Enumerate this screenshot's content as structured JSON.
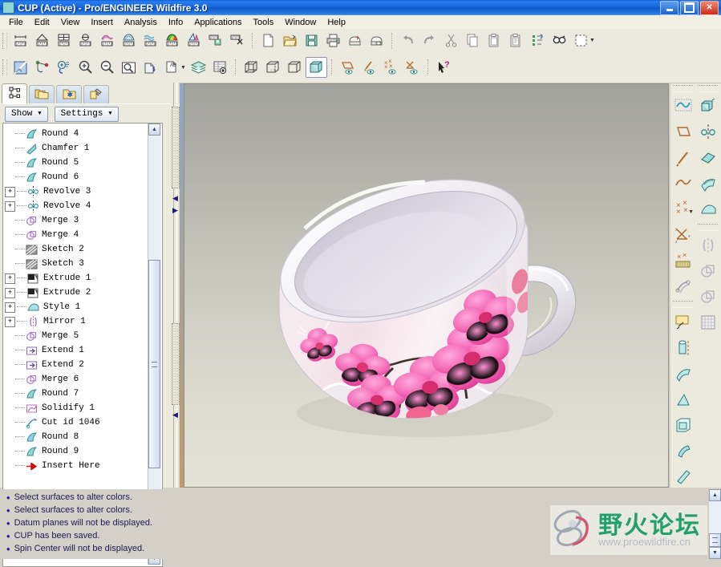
{
  "window": {
    "title": "CUP (Active) - Pro/ENGINEER Wildfire 3.0",
    "app_icon": "cup-model-icon",
    "minimize_label": "Minimize",
    "maximize_label": "Maximize",
    "close_label": "Close",
    "close_glyph": "✕"
  },
  "menubar": {
    "items": [
      {
        "label": "File"
      },
      {
        "label": "Edit"
      },
      {
        "label": "View"
      },
      {
        "label": "Insert"
      },
      {
        "label": "Analysis"
      },
      {
        "label": "Info"
      },
      {
        "label": "Applications"
      },
      {
        "label": "Tools"
      },
      {
        "label": "Window"
      },
      {
        "label": "Help"
      }
    ]
  },
  "toolbar_analysis": {
    "buttons": [
      {
        "name": "measure-distance-icon",
        "title": "Distance"
      },
      {
        "name": "measure-angle-icon",
        "title": "Angle"
      },
      {
        "name": "measure-area-icon",
        "title": "Area"
      },
      {
        "name": "measure-diameter-icon",
        "title": "Diameter"
      },
      {
        "name": "curvature-analysis-icon",
        "title": "Curvature"
      },
      {
        "name": "surface-analysis-icon",
        "title": "Surface Analysis"
      },
      {
        "name": "section-analysis-icon",
        "title": "Sections"
      },
      {
        "name": "shaded-curvature-icon",
        "title": "Shaded Curvature"
      },
      {
        "name": "draft-check-icon",
        "title": "Draft Check"
      },
      {
        "name": "save-analysis-icon",
        "title": "Save Analysis"
      },
      {
        "name": "delete-analysis-icon",
        "title": "Delete Analysis"
      }
    ]
  },
  "toolbar_file": {
    "buttons": [
      {
        "name": "new-file-icon",
        "title": "New"
      },
      {
        "name": "open-file-icon",
        "title": "Open"
      },
      {
        "name": "save-file-icon",
        "title": "Save"
      },
      {
        "name": "print-icon",
        "title": "Print"
      },
      {
        "name": "mail-model-icon",
        "title": "Send Mail"
      },
      {
        "name": "web-link-icon",
        "title": "Web Link"
      },
      {
        "name": "undo-icon",
        "title": "Undo"
      },
      {
        "name": "redo-icon",
        "title": "Redo"
      },
      {
        "name": "cut-icon",
        "title": "Cut"
      },
      {
        "name": "copy-icon",
        "title": "Copy"
      },
      {
        "name": "paste-icon",
        "title": "Paste"
      },
      {
        "name": "paste-special-icon",
        "title": "Paste Special"
      },
      {
        "name": "regenerate-icon",
        "title": "Regenerate"
      },
      {
        "name": "find-icon",
        "title": "Search"
      },
      {
        "name": "selection-filter-icon",
        "title": "Selection Filter"
      }
    ]
  },
  "toolbar_view": {
    "buttons": [
      {
        "name": "repaint-icon",
        "title": "Repaint"
      },
      {
        "name": "spin-center-icon",
        "title": "Spin Center"
      },
      {
        "name": "orientation-icon",
        "title": "Reorient"
      },
      {
        "name": "zoom-in-icon",
        "title": "Zoom In"
      },
      {
        "name": "zoom-out-icon",
        "title": "Zoom Out"
      },
      {
        "name": "refit-icon",
        "title": "Refit"
      },
      {
        "name": "saved-views-icon",
        "title": "Saved Views"
      },
      {
        "name": "annotation-display-icon",
        "title": "Annotations"
      },
      {
        "name": "layers-icon",
        "title": "Layers"
      },
      {
        "name": "view-manager-icon",
        "title": "View Manager"
      },
      {
        "name": "wireframe-icon",
        "title": "Wireframe"
      },
      {
        "name": "hidden-line-icon",
        "title": "Hidden Line"
      },
      {
        "name": "no-hidden-icon",
        "title": "No Hidden"
      },
      {
        "name": "shading-icon",
        "title": "Shading"
      },
      {
        "name": "datum-plane-toggle-icon",
        "title": "Datum Planes On/Off"
      },
      {
        "name": "datum-axis-toggle-icon",
        "title": "Datum Axes On/Off"
      },
      {
        "name": "datum-point-toggle-icon",
        "title": "Datum Points On/Off"
      },
      {
        "name": "coordinate-system-toggle-icon",
        "title": "Coordinate Systems On/Off"
      },
      {
        "name": "context-help-icon",
        "title": "Context Sensitive Help"
      }
    ],
    "active_index": 13
  },
  "navigator": {
    "tabs": [
      {
        "name": "tab-model-tree",
        "icon": "model-tree-icon",
        "active": true
      },
      {
        "name": "tab-folder-browser",
        "icon": "folder-browser-icon",
        "active": false
      },
      {
        "name": "tab-favorites",
        "icon": "favorites-folder-icon",
        "active": false
      },
      {
        "name": "tab-connections",
        "icon": "connections-icon",
        "active": false
      }
    ],
    "show_button": "Show",
    "settings_button": "Settings",
    "caret": "▼",
    "scroll_up": "▲",
    "scroll_down": "▼"
  },
  "model_tree": {
    "items": [
      {
        "label": "Round 4",
        "icon": "round-icon",
        "expandable": false
      },
      {
        "label": "Chamfer 1",
        "icon": "chamfer-icon",
        "expandable": false
      },
      {
        "label": "Round 5",
        "icon": "round-icon",
        "expandable": false
      },
      {
        "label": "Round 6",
        "icon": "round-icon",
        "expandable": false
      },
      {
        "label": "Revolve 3",
        "icon": "revolve-icon",
        "expandable": true
      },
      {
        "label": "Revolve 4",
        "icon": "revolve-icon",
        "expandable": true
      },
      {
        "label": "Merge 3",
        "icon": "merge-icon",
        "expandable": false
      },
      {
        "label": "Merge 4",
        "icon": "merge-icon",
        "expandable": false
      },
      {
        "label": "Sketch 2",
        "icon": "sketch-icon",
        "expandable": false
      },
      {
        "label": "Sketch 3",
        "icon": "sketch-icon",
        "expandable": false
      },
      {
        "label": "Extrude 1",
        "icon": "extrude-icon",
        "expandable": true
      },
      {
        "label": "Extrude 2",
        "icon": "extrude-icon",
        "expandable": true
      },
      {
        "label": "Style 1",
        "icon": "style-icon",
        "expandable": true
      },
      {
        "label": "Mirror 1",
        "icon": "mirror-icon",
        "expandable": true
      },
      {
        "label": "Merge 5",
        "icon": "merge-icon",
        "expandable": false
      },
      {
        "label": "Extend 1",
        "icon": "extend-icon",
        "expandable": false
      },
      {
        "label": "Extend 2",
        "icon": "extend-icon",
        "expandable": false
      },
      {
        "label": "Merge 6",
        "icon": "merge-icon",
        "expandable": false
      },
      {
        "label": "Round 7",
        "icon": "round-icon",
        "expandable": false
      },
      {
        "label": "Solidify 1",
        "icon": "solidify-icon",
        "expandable": false
      },
      {
        "label": "Cut id 1046",
        "icon": "cut-feature-icon",
        "expandable": false
      },
      {
        "label": "Round 8",
        "icon": "round-icon",
        "expandable": false
      },
      {
        "label": "Round 9",
        "icon": "round-icon",
        "expandable": false
      },
      {
        "label": "Insert Here",
        "icon": "insert-here-arrow-icon",
        "expandable": false
      }
    ],
    "expand_glyph": "+"
  },
  "right_toolbar": {
    "column_a": [
      {
        "name": "curve-tool-icon",
        "title": "Curve"
      },
      {
        "name": "datum-plane-tool-icon",
        "title": "Datum Plane"
      },
      {
        "name": "datum-axis-tool-icon",
        "title": "Datum Axis"
      },
      {
        "name": "sketch-spline-tool-icon",
        "title": "Sketched Curve"
      },
      {
        "name": "datum-point-tool-icon",
        "title": "Datum Point"
      },
      {
        "name": "coordinate-system-tool-icon",
        "title": "Coordinate System"
      },
      {
        "name": "datum-point-field-icon",
        "title": "Field Point"
      },
      {
        "name": "offset-curve-icon",
        "title": "Offset Curve"
      },
      {
        "name": "sketch-tool-icon",
        "title": "Sketch Tool"
      },
      {
        "name": "revolve-tool-icon",
        "title": "Revolve"
      },
      {
        "name": "sweep-blend-icon",
        "title": "Sweep Blend"
      },
      {
        "name": "draft-tool-icon",
        "title": "Draft"
      },
      {
        "name": "shell-tool-icon",
        "title": "Shell"
      },
      {
        "name": "rib-tool-icon",
        "title": "Rib"
      },
      {
        "name": "chamfer-tool-icon",
        "title": "Chamfer"
      }
    ],
    "column_b": [
      {
        "name": "extrude-tool-icon",
        "title": "Extrude"
      },
      {
        "name": "mirror-geom-icon",
        "title": "Mirror Geometry"
      },
      {
        "name": "blend-surface-icon",
        "title": "Blend Surface"
      },
      {
        "name": "boundary-blend-icon",
        "title": "Boundary Blend"
      },
      {
        "name": "style-surface-icon",
        "title": "Style"
      },
      {
        "name": "mirror-tool-icon",
        "title": "Mirror"
      },
      {
        "name": "merge-tool-icon",
        "title": "Merge"
      },
      {
        "name": "trim-tool-icon",
        "title": "Trim"
      },
      {
        "name": "pattern-tool-icon",
        "title": "Pattern"
      }
    ]
  },
  "messages": {
    "lines": [
      "Select surfaces to alter colors.",
      "Select surfaces to alter colors.",
      "Datum planes will not be displayed.",
      "CUP has been saved.",
      "Spin Center will not be displayed."
    ],
    "bullet": "•"
  },
  "watermark": {
    "chinese": "野火论坛",
    "url": "www.proewildfire.cn"
  },
  "model": {
    "name": "CUP",
    "description": "white ceramic mug with pink orchid decal"
  },
  "colors": {
    "title_bar": "#1566dd",
    "toolbar_bg": "#eceade",
    "viewport_top": "#a2a29c",
    "viewport_bottom": "#e3e1d4",
    "message_text": "#1a1a55",
    "watermark_green": "#22a06b",
    "tree_icon_cyan": "#7fd5db",
    "tree_icon_purple": "#b08fd0",
    "insert_arrow_red": "#cc1111"
  }
}
